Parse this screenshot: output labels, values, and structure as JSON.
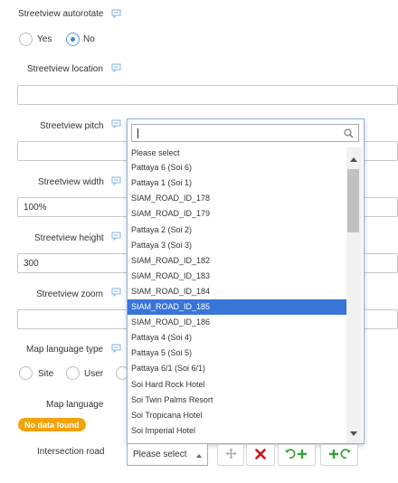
{
  "fields": {
    "autorotate": {
      "label": "Streetview autorotate",
      "options": [
        "Yes",
        "No"
      ],
      "selected": "No"
    },
    "location": {
      "label": "Streetview location",
      "value": ""
    },
    "pitch": {
      "label": "Streetview pitch",
      "value": ""
    },
    "width": {
      "label": "Streetview width",
      "value": "100%"
    },
    "height": {
      "label": "Streetview height",
      "value": "300"
    },
    "zoom": {
      "label": "Streetview zoom",
      "value": ""
    },
    "map_language_type": {
      "label": "Map language type",
      "options": [
        "Site",
        "User",
        ""
      ]
    },
    "map_language": {
      "label": "Map language",
      "badge": "No data found"
    },
    "intersection_road": {
      "label": "Intersection road",
      "selected": "Please select"
    }
  },
  "dropdown": {
    "search_value": "",
    "items": [
      "Please select",
      "Pattaya 6 (Soi 6)",
      "Pattaya 1 (Soi 1)",
      "SIAM_ROAD_ID_178",
      "SIAM_ROAD_ID_179",
      "Pattaya 2 (Soi 2)",
      "Pattaya 3 (Soi 3)",
      "SIAM_ROAD_ID_182",
      "SIAM_ROAD_ID_183",
      "SIAM_ROAD_ID_184",
      "SIAM_ROAD_ID_185",
      "SIAM_ROAD_ID_186",
      "Pattaya 4 (Soi 4)",
      "Pattaya 5 (Soi 5)",
      "Pattaya 6/1 (Soi 6/1)",
      "Soi Hard Rock Hotel",
      "Soi Twin Palms Resort",
      "Soi Tropicana Hotel",
      "Soi Imperial Hotel"
    ],
    "highlighted": "SIAM_ROAD_ID_185"
  },
  "icons": {
    "help": "speech-bubble-icon",
    "search": "magnifier-icon",
    "move": "move-arrows-icon",
    "delete": "red-x-icon",
    "add_before": "green-add-rotate-left-icon",
    "add_after": "green-add-rotate-right-icon"
  },
  "colors": {
    "accent_blue": "#3875d7",
    "badge_orange": "#f0a30a",
    "delete_red": "#cc1111",
    "add_green": "#3aa33a",
    "help_blue": "#7fb3e0"
  }
}
